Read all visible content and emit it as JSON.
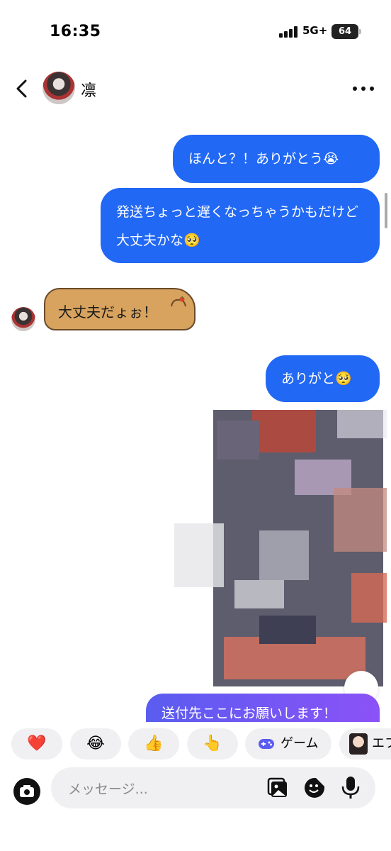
{
  "status_bar": {
    "time": "16:35",
    "network": "5G+",
    "battery": "64"
  },
  "header": {
    "contact_name": "凛"
  },
  "messages": {
    "out1": "ほんと？！ありがとう😭",
    "out2": "発送ちょっと遅くなっちゃうかもだけど大丈夫かな🥺",
    "in1": "大丈夫だょぉ！",
    "out3": "ありがと🥺",
    "out4": "送付先ここにお願いします！"
  },
  "reactions": {
    "heart": "❤️",
    "laugh": "😂",
    "thumbs_up": "👍",
    "point": "👆",
    "game_label": "ゲーム",
    "effect_label": "エフ"
  },
  "composer": {
    "placeholder": "メッセージ..."
  },
  "colors": {
    "accent": "#2168f4",
    "gradient_end": "#8b52f7",
    "chip_bg": "#f0f0f2"
  }
}
